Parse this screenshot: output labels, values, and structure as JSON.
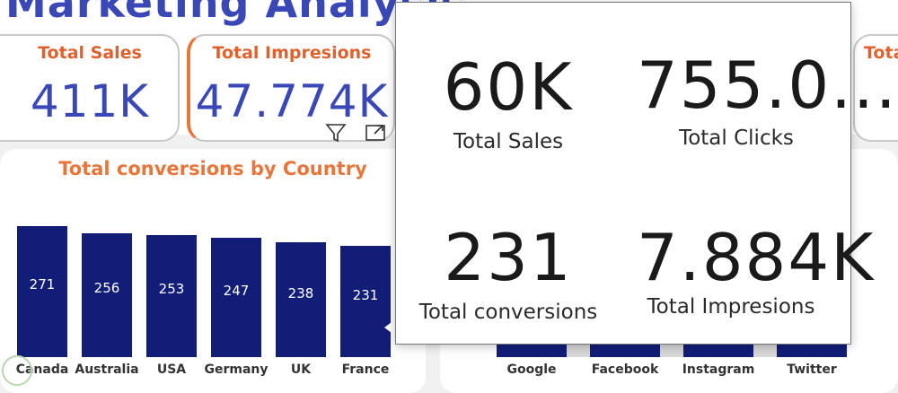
{
  "header": {
    "title": "Marketing Analysis"
  },
  "kpis": [
    {
      "label": "Total Sales",
      "value": "411K"
    },
    {
      "label": "Total Impresions",
      "value": "47.774K"
    },
    {
      "label": "Tota"
    }
  ],
  "chart": {
    "title": "Total conversions by Country"
  },
  "chart_data": [
    {
      "type": "bar",
      "title": "Total conversions by Country",
      "categories": [
        "Canada",
        "Australia",
        "USA",
        "Germany",
        "UK",
        "France"
      ],
      "values": [
        271,
        256,
        253,
        247,
        238,
        231
      ],
      "ylim": [
        0,
        271
      ],
      "grid": false,
      "data_labels": true
    },
    {
      "type": "bar",
      "categories": [
        "Google",
        "Facebook",
        "Instagram",
        "Twitter"
      ]
    }
  ],
  "popup": {
    "cards": [
      {
        "value": "60K",
        "label": "Total Sales"
      },
      {
        "value": "755.0...",
        "label": "Total Clicks"
      },
      {
        "value": "231",
        "label": "Total conversions"
      },
      {
        "value": "7.884K",
        "label": "Total Impresions"
      }
    ]
  },
  "icons": {
    "filter": "filter-icon",
    "focus": "focus-mode-icon"
  },
  "colors": {
    "bar": "#121d78",
    "title_blue": "#3a48b7",
    "accent_orange": "#e8763a"
  }
}
